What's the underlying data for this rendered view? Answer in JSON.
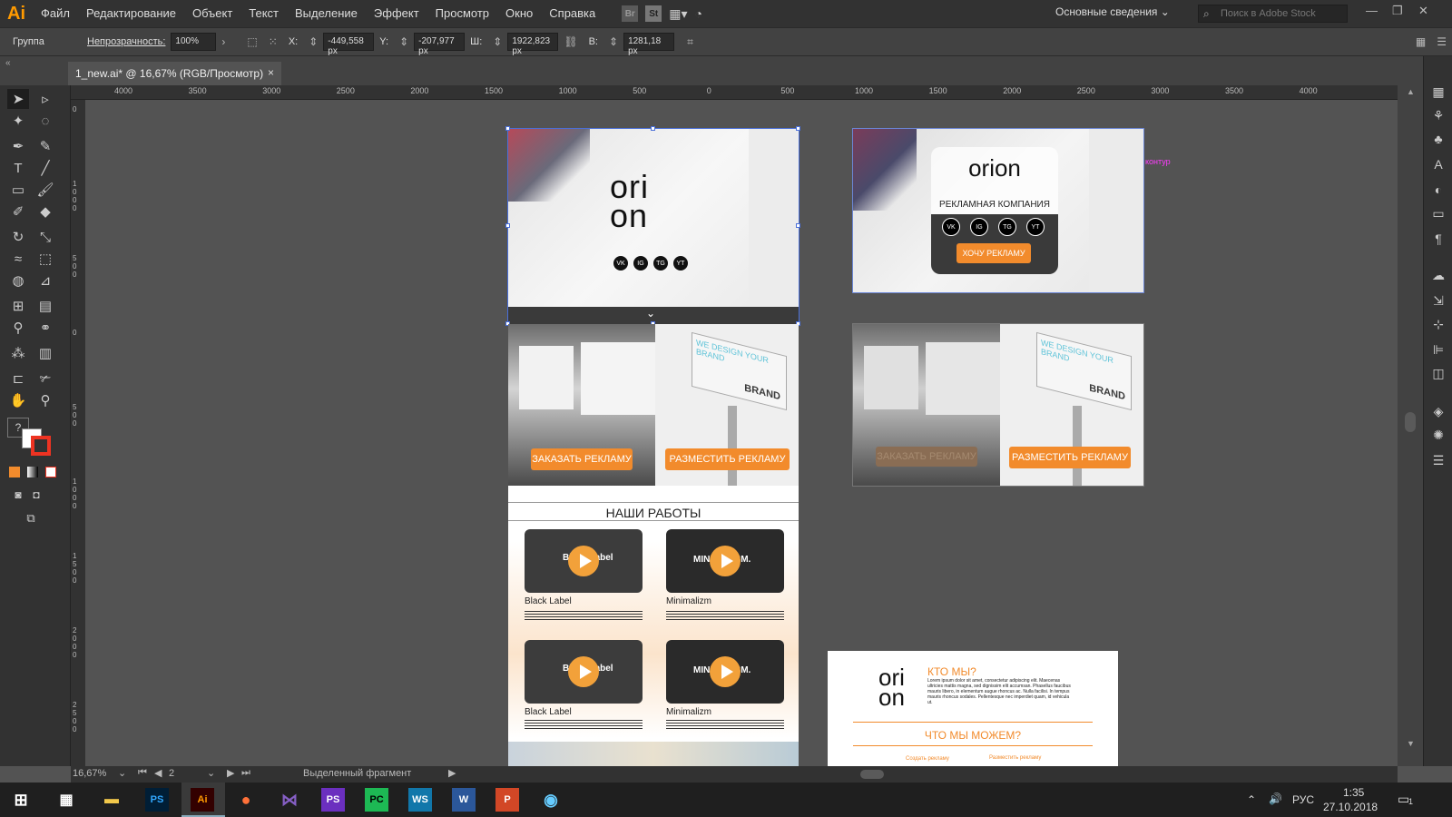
{
  "app": {
    "logo": "Ai"
  },
  "menu": [
    "Файл",
    "Редактирование",
    "Объект",
    "Текст",
    "Выделение",
    "Эффект",
    "Просмотр",
    "Окно",
    "Справка"
  ],
  "menu_icons": {
    "br": "Br",
    "st": "St"
  },
  "workspace": "Основные сведения",
  "search_placeholder": "Поиск в Adobe Stock",
  "control": {
    "selection": "Группа",
    "opacity_label": "Непрозрачность:",
    "opacity": "100%",
    "x_label": "X:",
    "x": "-449,558 px",
    "y_label": "Y:",
    "y": "-207,977 px",
    "w_label": "Ш:",
    "w": "1922,823 px",
    "h_label": "В:",
    "h": "1281,18 px"
  },
  "tab": {
    "title": "1_new.ai* @ 16,67% (RGB/Просмотр)",
    "close": "×"
  },
  "ruler_h": [
    "4000",
    "3500",
    "3000",
    "2500",
    "2000",
    "1500",
    "1000",
    "500",
    "0",
    "500",
    "1000",
    "1500",
    "2000",
    "2500",
    "3000",
    "3500",
    "4000"
  ],
  "ruler_v": [
    "0",
    "1000",
    "500",
    "0",
    "500",
    "1000",
    "1500",
    "2000",
    "2500"
  ],
  "artboards": {
    "hero": {
      "brand": "ori on",
      "social": [
        "VK",
        "IG",
        "TG",
        "YT"
      ]
    },
    "hero2": {
      "brand": "orion",
      "subtitle": "РЕКЛАМНАЯ КОМПАНИЯ",
      "cta": "ХОЧУ РЕКЛАМУ",
      "social": [
        "VK",
        "IG",
        "TG",
        "YT"
      ]
    },
    "path_label": "контур",
    "billboard": {
      "order": "ЗАКАЗАТЬ РЕКЛАМУ",
      "place": "РАЗМЕСТИТЬ РЕКЛАМУ",
      "billboard_text": "WE DESIGN YOUR BRAND",
      "brand_text": "BRAND"
    },
    "works": {
      "title": "НАШИ РАБОТЫ",
      "items": [
        {
          "title": "Black Label",
          "thumb": "Black Label"
        },
        {
          "title": "Minimalizm",
          "thumb": "MINIMALISM."
        },
        {
          "title": "Black Label",
          "thumb": "Black Label"
        },
        {
          "title": "Minimalizm",
          "thumb": "MINIMALISM."
        }
      ]
    },
    "about": {
      "who": "КТО МЫ?",
      "what": "ЧТО МЫ МОЖЕМ?",
      "lorem": "Lorem ipsum dolor sit amet, consectetur adipiscing elit. Maecenas ultricies mattis magna, sed dignissim elit accumsan. Phasellus faucibus mauris libero, in elementum augue rhoncus ac. Nulla facilisi. In tempus mauris rhoncus sodales. Pellentesque nec imperdiet quam, id vehicula ut.",
      "left_link": "Создать рекламу",
      "right_link": "Разместить рекламу"
    }
  },
  "status": {
    "zoom": "16,67%",
    "artboard": "2",
    "selection": "Выделенный фрагмент"
  },
  "tray": {
    "lang": "РУС",
    "time": "1:35",
    "date": "27.10.2018",
    "notif": "1"
  },
  "taskbar_apps": [
    "PS",
    "Ai",
    "PS",
    "PC",
    "WS",
    "W",
    "P"
  ]
}
